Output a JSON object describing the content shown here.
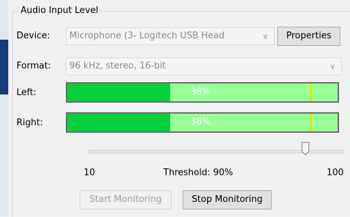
{
  "group_title": "Audio Input Level",
  "device": {
    "label": "Device:",
    "value": "Microphone (3- Logitech USB Head",
    "properties_label": "Properties"
  },
  "format": {
    "label": "Format:",
    "value": "96 kHz, stereo, 16-bit"
  },
  "meters": {
    "left": {
      "label": "Left:",
      "level": 0.38,
      "peak": 0.9,
      "text": "38%"
    },
    "right": {
      "label": "Right:",
      "level": 0.38,
      "peak": 0.9,
      "text": "38%"
    }
  },
  "threshold": {
    "min_label": "10",
    "max_label": "100",
    "label": "Threshold: 90%",
    "value": 90,
    "min": 10,
    "max": 100
  },
  "buttons": {
    "start": "Start Monitoring",
    "stop": "Stop Monitoring"
  },
  "colors": {
    "meter_fill": "#06d13c",
    "meter_bg": "#99ff99",
    "peak": "#e6e600"
  }
}
